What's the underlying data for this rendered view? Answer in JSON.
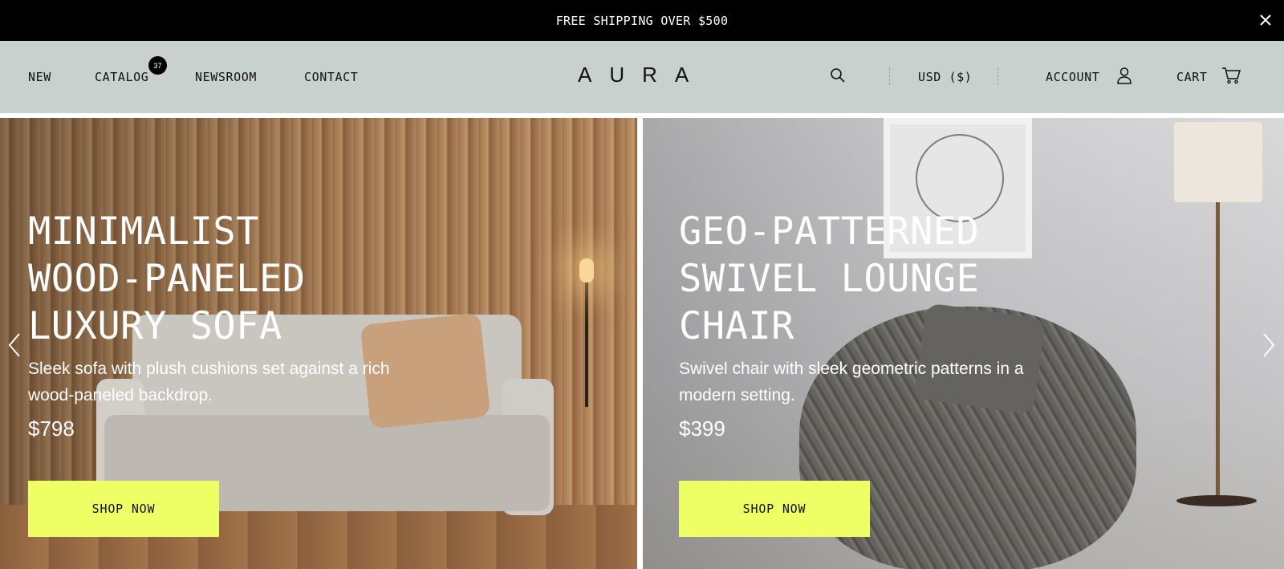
{
  "announcement": {
    "text": "FREE SHIPPING OVER $500",
    "close_icon": "close-icon"
  },
  "header": {
    "nav": [
      {
        "label": "NEW"
      },
      {
        "label": "CATALOG",
        "badge": "37"
      },
      {
        "label": "NEWSROOM"
      },
      {
        "label": "CONTACT"
      }
    ],
    "logo": "AURA",
    "search_icon": "search-icon",
    "currency": "USD ($)",
    "account": {
      "label": "ACCOUNT",
      "icon": "user-icon"
    },
    "cart": {
      "label": "CART",
      "icon": "cart-icon"
    }
  },
  "hero": {
    "slides": [
      {
        "title_lines": [
          "MINIMALIST",
          "WOOD-PANELED",
          "LUXURY SOFA"
        ],
        "description": "Sleek sofa with plush cushions set against a rich wood-paneled backdrop.",
        "price": "$798",
        "button": "SHOP NOW"
      },
      {
        "title_lines": [
          "GEO-PATTERNED",
          "SWIVEL LOUNGE",
          "CHAIR"
        ],
        "description": "Swivel chair with sleek geometric patterns in a modern setting.",
        "price": "$399",
        "button": "SHOP NOW"
      }
    ],
    "prev_icon": "chevron-left-icon",
    "next_icon": "chevron-right-icon"
  },
  "colors": {
    "announcement_bg": "#000000",
    "header_bg": "#c8d1cd",
    "button_bg": "#eeff66",
    "badge_bg": "#000000"
  }
}
